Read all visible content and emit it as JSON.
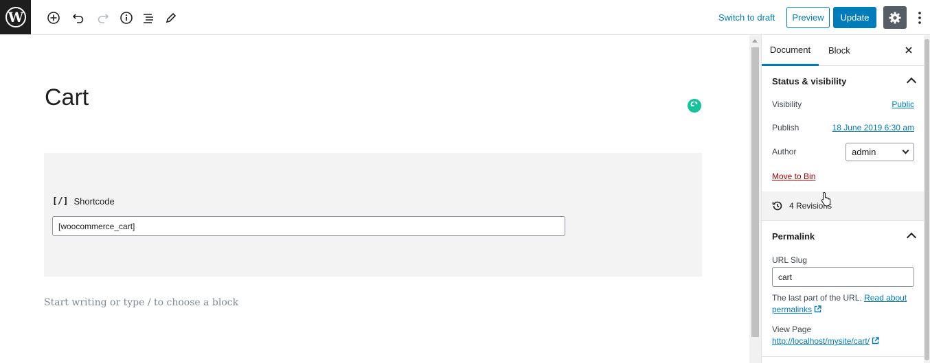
{
  "header": {
    "switch_draft": "Switch to draft",
    "preview": "Preview",
    "update": "Update"
  },
  "editor": {
    "title": "Cart",
    "shortcode_label": "Shortcode",
    "shortcode_icon": "[/]",
    "shortcode_value": "[woocommerce_cart]",
    "placeholder": "Start writing or type / to choose a block"
  },
  "sidebar": {
    "tabs": [
      "Document",
      "Block"
    ],
    "status": {
      "heading": "Status & visibility",
      "visibility_label": "Visibility",
      "visibility_value": "Public",
      "publish_label": "Publish",
      "publish_value": "18 June 2019 6:30 am",
      "author_label": "Author",
      "author_value": "admin",
      "move_to_bin": "Move to Bin"
    },
    "revisions": "4 Revisions",
    "permalink": {
      "heading": "Permalink",
      "slug_label": "URL Slug",
      "slug_value": "cart",
      "help_prefix": "The last part of the URL.",
      "help_link": "Read about permalinks",
      "view_label": "View Page",
      "view_url": "http://localhost/mysite/cart/"
    }
  },
  "colors": {
    "accent": "#007cba",
    "danger": "#a00",
    "dark": "#1e1e1e"
  }
}
